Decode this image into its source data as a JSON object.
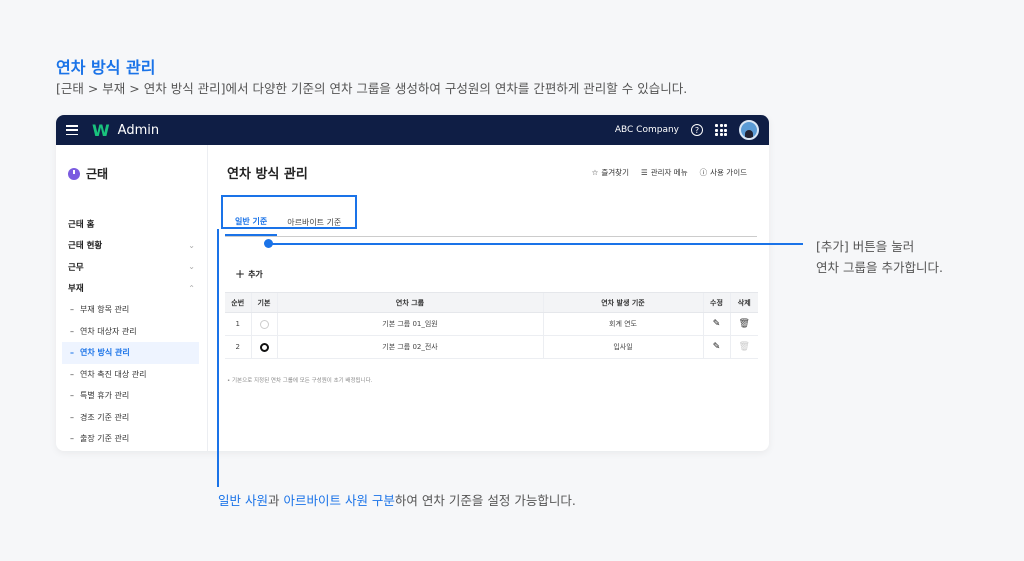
{
  "header": {
    "title": "연차 방식 관리",
    "description": "[근태 > 부재 > 연차 방식 관리]에서 다양한 기준의 연차 그룹을 생성하여 구성원의 연차를 간편하게 관리할 수 있습니다."
  },
  "topbar": {
    "logo": "W",
    "app_name": "Admin",
    "company": "ABC Company",
    "help": "?"
  },
  "sidebar": {
    "title": "근태",
    "items": [
      {
        "label": "근태 홈",
        "chevron": ""
      },
      {
        "label": "근태 현황",
        "chevron": "⌄"
      },
      {
        "label": "근무",
        "chevron": "⌄"
      },
      {
        "label": "부재",
        "chevron": "⌃"
      }
    ],
    "sub_items": [
      {
        "label": "부재 항목 관리"
      },
      {
        "label": "연차 대상자 관리"
      },
      {
        "label": "연차 방식 관리"
      },
      {
        "label": "연차 촉진 대상 관리"
      },
      {
        "label": "특별 휴가 관리"
      },
      {
        "label": "경조 기준 관리"
      },
      {
        "label": "출장 기준 관리"
      }
    ]
  },
  "main": {
    "title": "연차 방식 관리",
    "links": {
      "favorites": "즐겨찾기",
      "admin_menu": "관리자 메뉴",
      "guide": "사용 가이드"
    },
    "tabs": [
      "일반 기준",
      "아르바이트 기준"
    ],
    "add_label": "추가",
    "table": {
      "headers": [
        "순번",
        "기본",
        "연차 그룹",
        "연차 발생 기준",
        "수정",
        "삭제"
      ],
      "rows": [
        {
          "no": "1",
          "group": "기본 그룹 01_임원",
          "basis": "회계 연도"
        },
        {
          "no": "2",
          "group": "기본 그룹 02_전사",
          "basis": "입사일"
        }
      ]
    },
    "note": "• 기본으로 지정된 연차 그룹에 모든 구성원이 초기 배정됩니다."
  },
  "callouts": {
    "add_line1": "[추가] 버튼을 눌러",
    "add_line2": "연차 그룹을 추가합니다.",
    "tabs_part1": "일반 사원",
    "tabs_part2": "과 ",
    "tabs_part3": "아르바이트 사원 구분",
    "tabs_part4": "하여 연차 기준을 설정 가능합니다."
  },
  "colors": {
    "accent": "#1a73e8",
    "topbar": "#0f1e45",
    "logo": "#19c37d"
  }
}
